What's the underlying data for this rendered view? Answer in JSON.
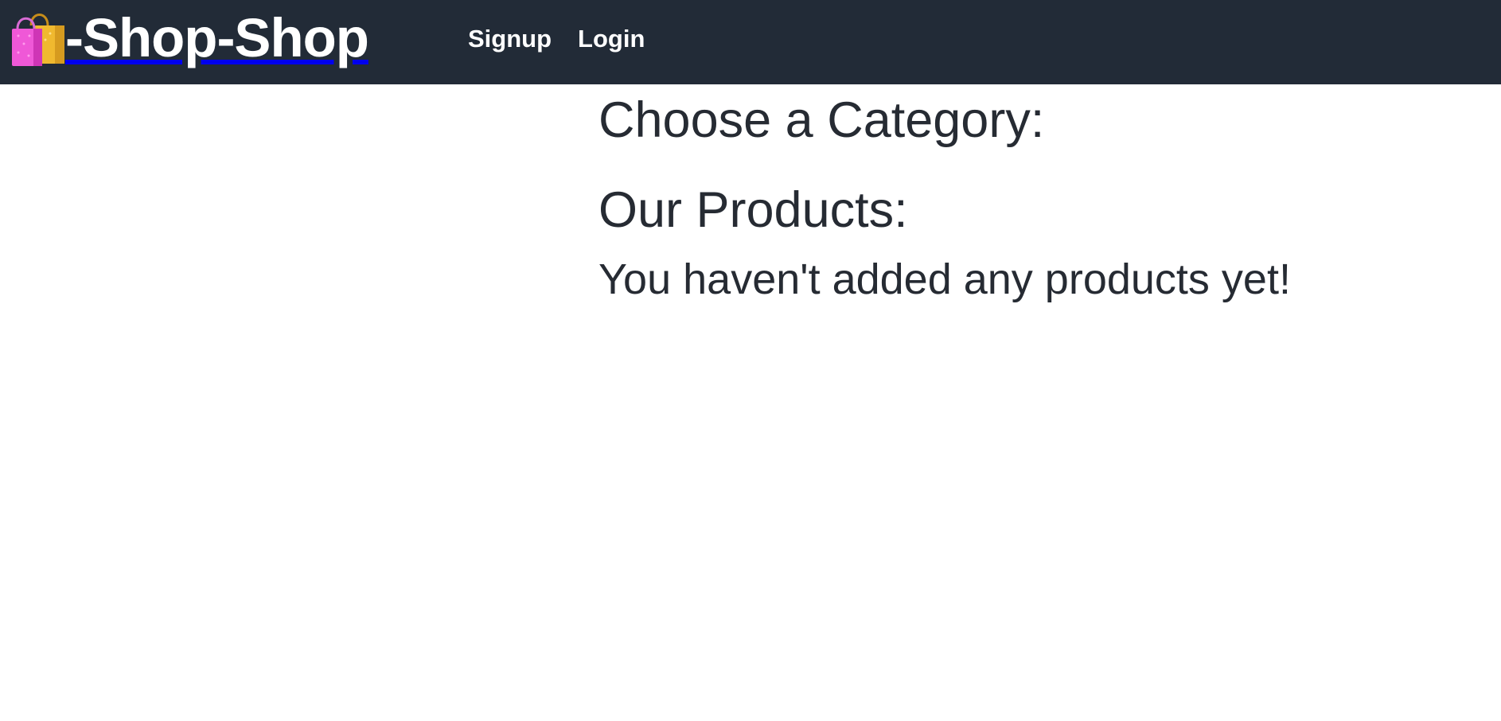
{
  "header": {
    "brand": {
      "icon": "shopping-bags-icon",
      "text": "-Shop-Shop"
    },
    "nav": {
      "signup": "Signup",
      "login": "Login"
    }
  },
  "main": {
    "category_heading": "Choose a Category:",
    "products_heading": "Our Products:",
    "empty_message": "You haven't added any products yet!"
  },
  "colors": {
    "header_background": "#222b37",
    "header_text": "#ffffff",
    "body_text": "#262b33",
    "page_background": "#ffffff"
  }
}
